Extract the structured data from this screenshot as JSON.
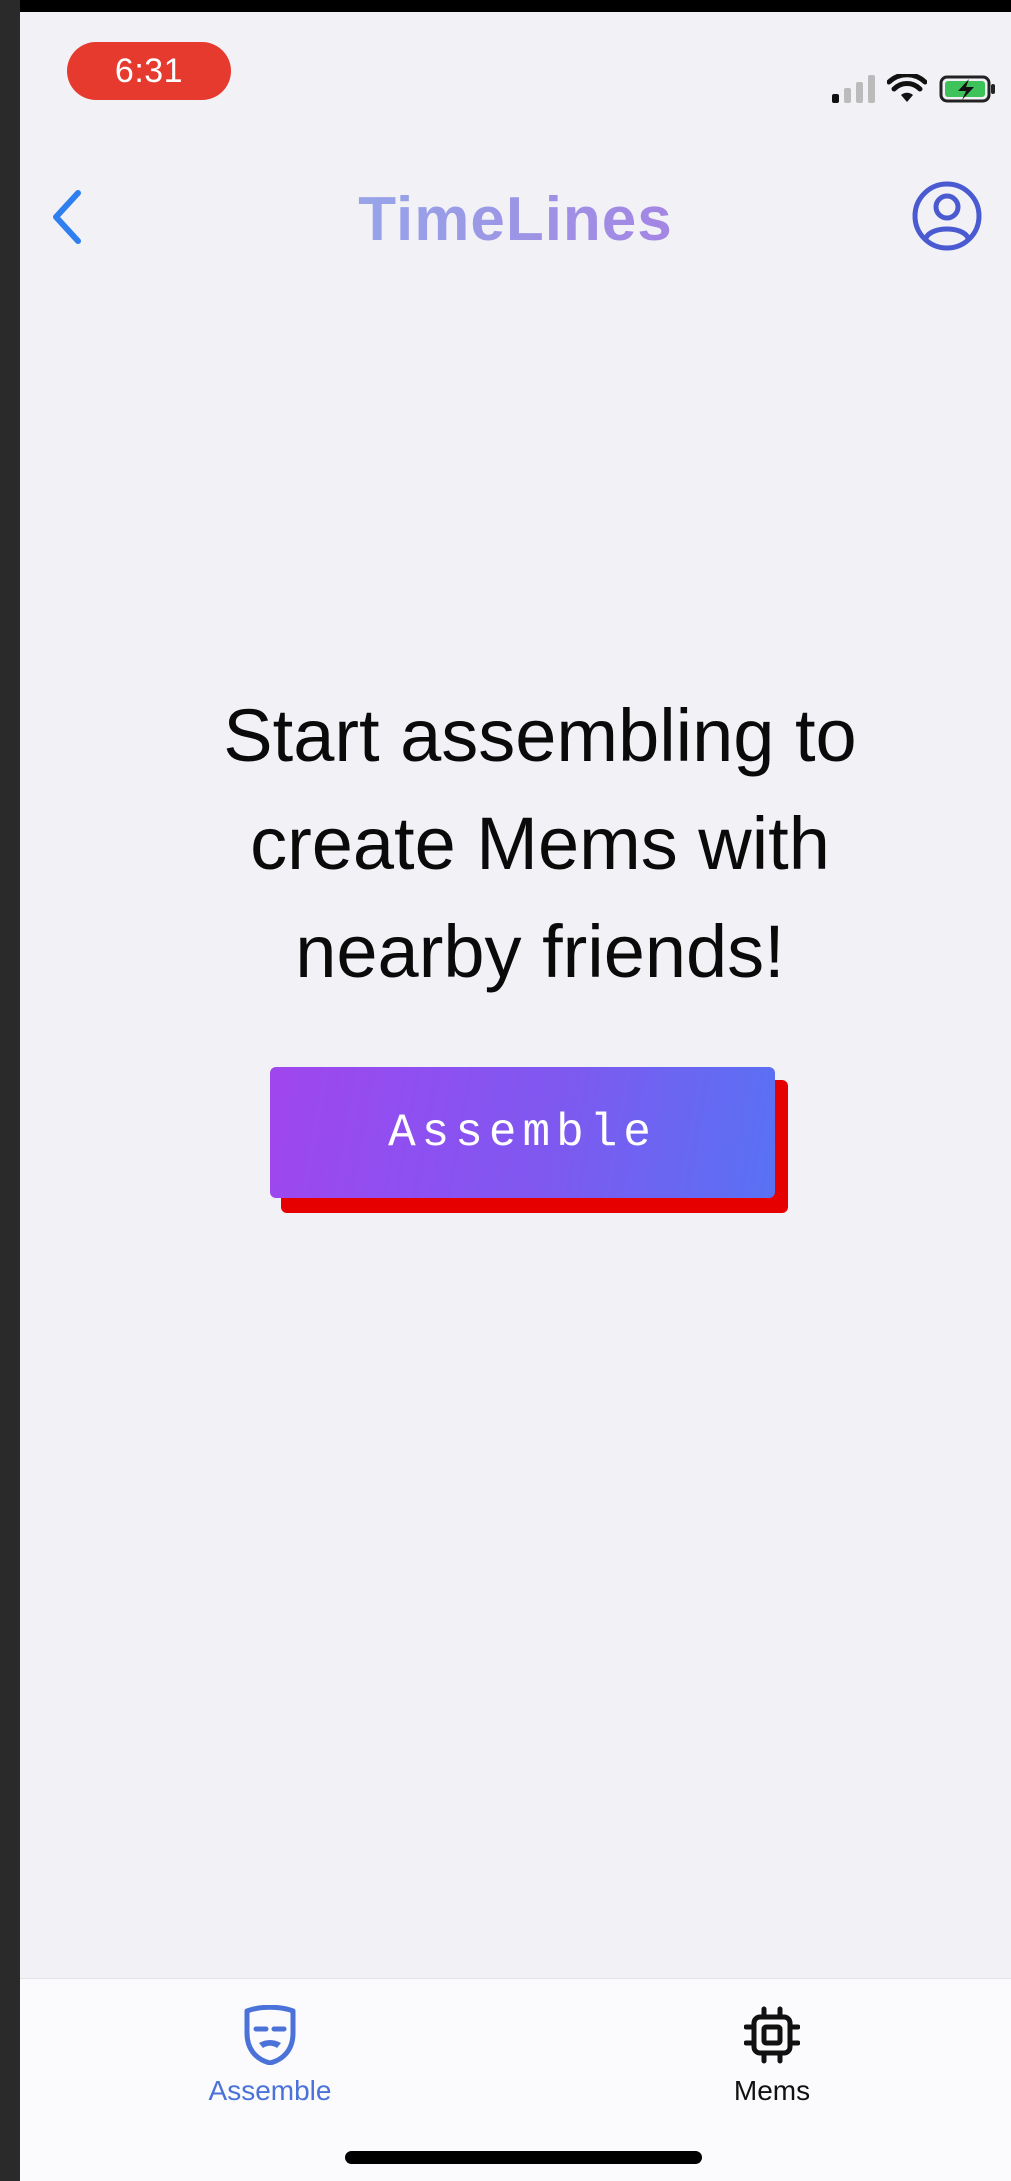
{
  "status_bar": {
    "time": "6:31",
    "time_pill_color": "#e63a2f",
    "icons": [
      "cellular-signal-icon",
      "wifi-icon",
      "battery-charging-icon"
    ]
  },
  "nav": {
    "title": "TimeLines",
    "back_icon": "chevron-left-icon",
    "profile_icon": "user-circle-icon",
    "accent_color": "#2f7ff0"
  },
  "main": {
    "headline": "Start assembling to create Mems with nearby friends!",
    "assemble_button_label": "Assemble",
    "button_gradient": [
      "#a046ef",
      "#5872f4"
    ],
    "button_shadow_color": "#e60000"
  },
  "tabbar": {
    "tabs": [
      {
        "label": "Assemble",
        "icon": "mask-icon",
        "active": true,
        "color": "#4a72d8"
      },
      {
        "label": "Mems",
        "icon": "cpu-chip-icon",
        "active": false,
        "color": "#111111"
      }
    ]
  }
}
